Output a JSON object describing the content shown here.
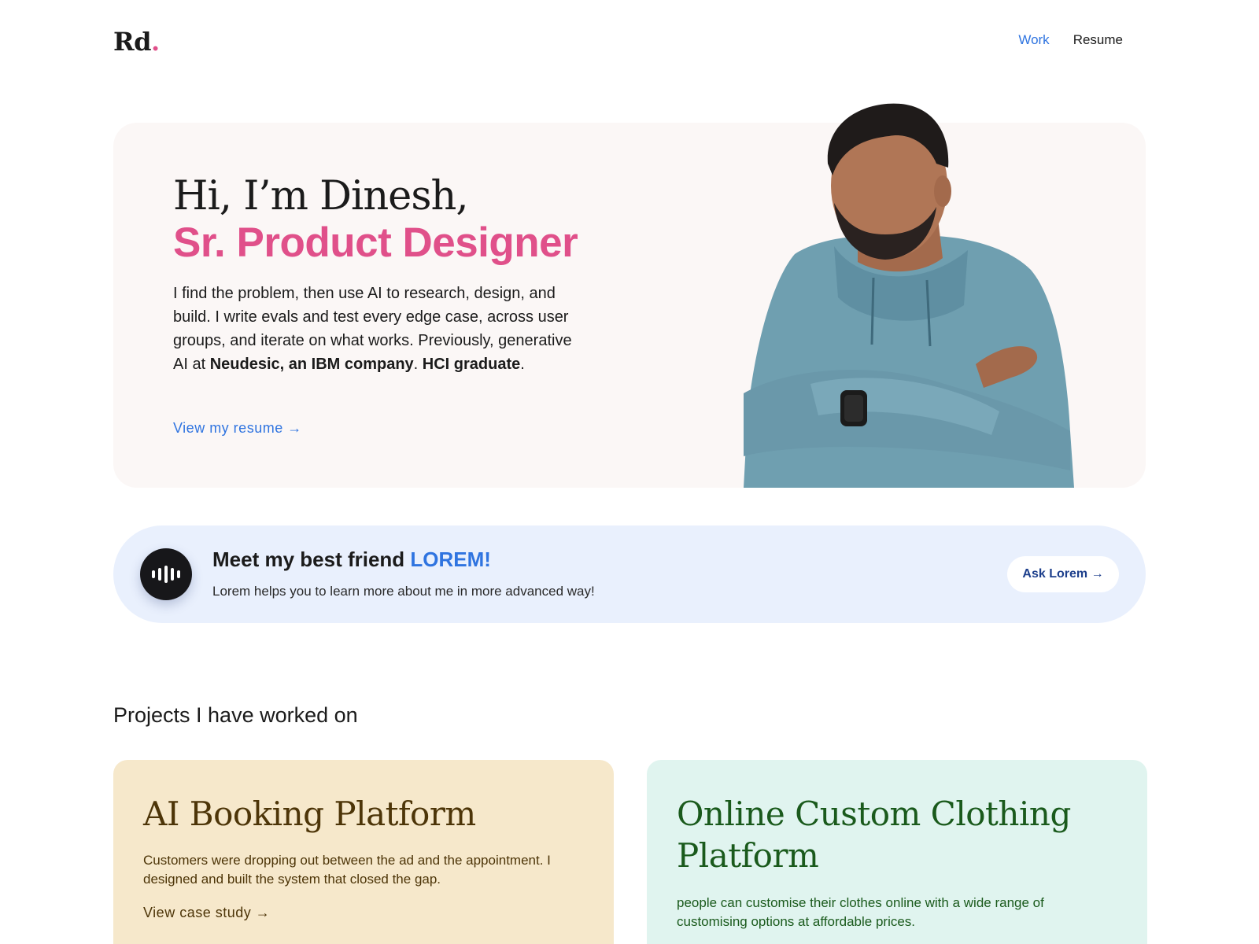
{
  "header": {
    "logo_text": "Rd",
    "logo_dot": ".",
    "nav": [
      {
        "label": "Work",
        "active": true
      },
      {
        "label": "Resume",
        "active": false
      }
    ]
  },
  "hero": {
    "greeting": "Hi, I’m Dinesh,",
    "role": "Sr. Product Designer",
    "bio_part1": "I find the problem, then use AI to research, design, and build. I write evals and test every edge case, across user groups, and iterate on what works. Previously, generative AI at ",
    "bio_company": "Neudesic, an IBM company",
    "bio_sep": ". ",
    "bio_degree": "HCI graduate",
    "bio_end": ".",
    "resume_link": "View my resume →"
  },
  "lorem_banner": {
    "title_prefix": "Meet my best friend ",
    "title_accent": "LOREM!",
    "subtitle": "Lorem helps you to learn more about me in more advanced way!",
    "button_label": "Ask Lorem →",
    "icon": "voice-wave-icon"
  },
  "projects": {
    "heading": "Projects I have worked on",
    "cards": [
      {
        "title": "AI Booking Platform",
        "description": "Customers were dropping out between the ad and the appointment. I designed and built the system that closed the gap.",
        "link": "View case study →"
      },
      {
        "title": "Online Custom Clothing Platform",
        "description": "people can customise their clothes online with a wide range of customising options at affordable prices."
      }
    ]
  },
  "colors": {
    "accent_pink": "#e0508a",
    "accent_blue": "#2f74e0",
    "hero_bg": "#fbf7f6",
    "banner_bg": "#e9f0fd",
    "card1_bg": "#f6e8cb",
    "card2_bg": "#e0f4ef"
  }
}
